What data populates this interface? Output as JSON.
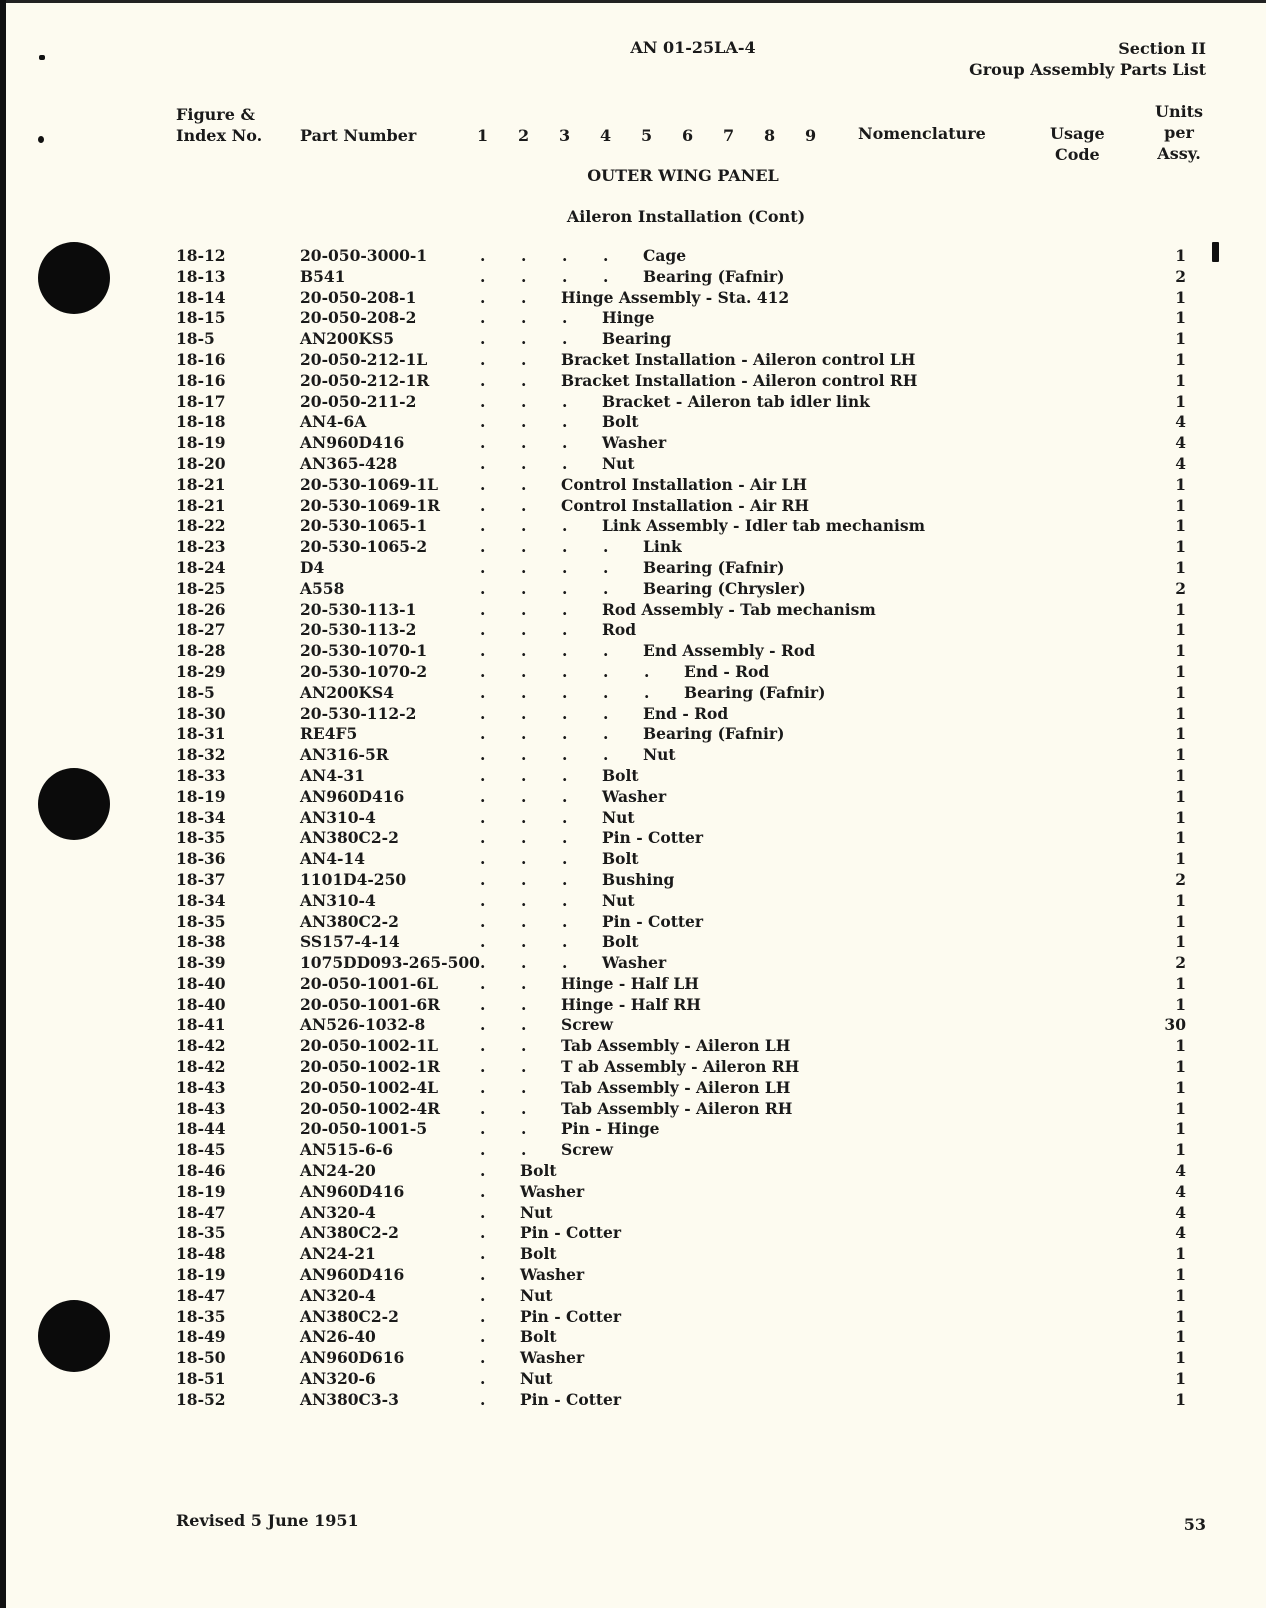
{
  "header": {
    "doc_number": "AN 01-25LA-4",
    "section": "Section II",
    "section_title": "Group Assembly Parts List"
  },
  "columns": {
    "figure_index": [
      "Figure &",
      "Index No."
    ],
    "part_number": "Part Number",
    "indent_levels": [
      "1",
      "2",
      "3",
      "4",
      "5",
      "6",
      "7",
      "8",
      "9"
    ],
    "nomenclature": "Nomenclature",
    "usage_code": [
      "Usage",
      "Code"
    ],
    "units_per_assy": [
      "Units",
      "per",
      "Assy."
    ]
  },
  "group_title": "OUTER WING PANEL",
  "subgroup_title": "Aileron Installation (Cont)",
  "parts": [
    {
      "fig": "18-12",
      "part": "20-050-3000-1",
      "indent": 4,
      "name": "Cage",
      "qty": "1"
    },
    {
      "fig": "18-13",
      "part": "B541",
      "indent": 4,
      "name": "Bearing (Fafnir)",
      "qty": "2"
    },
    {
      "fig": "18-14",
      "part": "20-050-208-1",
      "indent": 2,
      "name": "Hinge Assembly - Sta. 412",
      "qty": "1"
    },
    {
      "fig": "18-15",
      "part": "20-050-208-2",
      "indent": 3,
      "name": "Hinge",
      "qty": "1"
    },
    {
      "fig": "18-5",
      "part": "AN200KS5",
      "indent": 3,
      "name": "Bearing",
      "qty": "1"
    },
    {
      "fig": "18-16",
      "part": "20-050-212-1L",
      "indent": 2,
      "name": "Bracket Installation - Aileron control LH",
      "qty": "1"
    },
    {
      "fig": "18-16",
      "part": "20-050-212-1R",
      "indent": 2,
      "name": "Bracket Installation - Aileron control RH",
      "qty": "1"
    },
    {
      "fig": "18-17",
      "part": "20-050-211-2",
      "indent": 3,
      "name": "Bracket - Aileron tab idler link",
      "qty": "1"
    },
    {
      "fig": "18-18",
      "part": "AN4-6A",
      "indent": 3,
      "name": "Bolt",
      "qty": "4"
    },
    {
      "fig": "18-19",
      "part": "AN960D416",
      "indent": 3,
      "name": "Washer",
      "qty": "4"
    },
    {
      "fig": "18-20",
      "part": "AN365-428",
      "indent": 3,
      "name": "Nut",
      "qty": "4"
    },
    {
      "fig": "18-21",
      "part": "20-530-1069-1L",
      "indent": 2,
      "name": "Control Installation - Air LH",
      "qty": "1"
    },
    {
      "fig": "18-21",
      "part": "20-530-1069-1R",
      "indent": 2,
      "name": "Control Installation - Air RH",
      "qty": "1"
    },
    {
      "fig": "18-22",
      "part": "20-530-1065-1",
      "indent": 3,
      "name": "Link Assembly - Idler tab mechanism",
      "qty": "1"
    },
    {
      "fig": "18-23",
      "part": "20-530-1065-2",
      "indent": 4,
      "name": "Link",
      "qty": "1"
    },
    {
      "fig": "18-24",
      "part": "D4",
      "indent": 4,
      "name": "Bearing (Fafnir)",
      "qty": "1"
    },
    {
      "fig": "18-25",
      "part": "A558",
      "indent": 4,
      "name": "Bearing (Chrysler)",
      "qty": "2"
    },
    {
      "fig": "18-26",
      "part": "20-530-113-1",
      "indent": 3,
      "name": "Rod Assembly - Tab mechanism",
      "qty": "1"
    },
    {
      "fig": "18-27",
      "part": "20-530-113-2",
      "indent": 3,
      "name": "Rod",
      "qty": "1"
    },
    {
      "fig": "18-28",
      "part": "20-530-1070-1",
      "indent": 4,
      "name": "End Assembly - Rod",
      "qty": "1"
    },
    {
      "fig": "18-29",
      "part": "20-530-1070-2",
      "indent": 5,
      "name": "End - Rod",
      "qty": "1"
    },
    {
      "fig": "18-5",
      "part": "AN200KS4",
      "indent": 5,
      "name": "Bearing (Fafnir)",
      "qty": "1"
    },
    {
      "fig": "18-30",
      "part": "20-530-112-2",
      "indent": 4,
      "name": "End - Rod",
      "qty": "1"
    },
    {
      "fig": "18-31",
      "part": "RE4F5",
      "indent": 4,
      "name": "Bearing (Fafnir)",
      "qty": "1"
    },
    {
      "fig": "18-32",
      "part": "AN316-5R",
      "indent": 4,
      "name": "Nut",
      "qty": "1"
    },
    {
      "fig": "18-33",
      "part": "AN4-31",
      "indent": 3,
      "name": "Bolt",
      "qty": "1"
    },
    {
      "fig": "18-19",
      "part": "AN960D416",
      "indent": 3,
      "name": "Washer",
      "qty": "1"
    },
    {
      "fig": "18-34",
      "part": "AN310-4",
      "indent": 3,
      "name": "Nut",
      "qty": "1"
    },
    {
      "fig": "18-35",
      "part": "AN380C2-2",
      "indent": 3,
      "name": "Pin - Cotter",
      "qty": "1"
    },
    {
      "fig": "18-36",
      "part": "AN4-14",
      "indent": 3,
      "name": "Bolt",
      "qty": "1"
    },
    {
      "fig": "18-37",
      "part": "1101D4-250",
      "indent": 3,
      "name": "Bushing",
      "qty": "2"
    },
    {
      "fig": "18-34",
      "part": "AN310-4",
      "indent": 3,
      "name": "Nut",
      "qty": "1"
    },
    {
      "fig": "18-35",
      "part": "AN380C2-2",
      "indent": 3,
      "name": "Pin - Cotter",
      "qty": "1"
    },
    {
      "fig": "18-38",
      "part": "SS157-4-14",
      "indent": 3,
      "name": "Bolt",
      "qty": "1"
    },
    {
      "fig": "18-39",
      "part": "1075DD093-265-500.",
      "indent": 3,
      "name": "Washer",
      "qty": "2",
      "dots_from": 2
    },
    {
      "fig": "18-40",
      "part": "20-050-1001-6L",
      "indent": 2,
      "name": "Hinge - Half LH",
      "qty": "1"
    },
    {
      "fig": "18-40",
      "part": "20-050-1001-6R",
      "indent": 2,
      "name": "Hinge - Half RH",
      "qty": "1"
    },
    {
      "fig": "18-41",
      "part": "AN526-1032-8",
      "indent": 2,
      "name": "Screw",
      "qty": "30"
    },
    {
      "fig": "18-42",
      "part": "20-050-1002-1L",
      "indent": 2,
      "name": "Tab Assembly - Aileron LH",
      "qty": "1"
    },
    {
      "fig": "18-42",
      "part": "20-050-1002-1R",
      "indent": 2,
      "name": "T ab Assembly - Aileron RH",
      "qty": "1"
    },
    {
      "fig": "18-43",
      "part": "20-050-1002-4L",
      "indent": 2,
      "name": "Tab Assembly - Aileron LH",
      "qty": "1"
    },
    {
      "fig": "18-43",
      "part": "20-050-1002-4R",
      "indent": 2,
      "name": "Tab Assembly - Aileron RH",
      "qty": "1"
    },
    {
      "fig": "18-44",
      "part": "20-050-1001-5",
      "indent": 2,
      "name": "Pin - Hinge",
      "qty": "1"
    },
    {
      "fig": "18-45",
      "part": "AN515-6-6",
      "indent": 2,
      "name": "Screw",
      "qty": "1"
    },
    {
      "fig": "18-46",
      "part": "AN24-20",
      "indent": 1,
      "name": "Bolt",
      "qty": "4"
    },
    {
      "fig": "18-19",
      "part": "AN960D416",
      "indent": 1,
      "name": "Washer",
      "qty": "4"
    },
    {
      "fig": "18-47",
      "part": "AN320-4",
      "indent": 1,
      "name": "Nut",
      "qty": "4"
    },
    {
      "fig": "18-35",
      "part": "AN380C2-2",
      "indent": 1,
      "name": "Pin - Cotter",
      "qty": "4"
    },
    {
      "fig": "18-48",
      "part": "AN24-21",
      "indent": 1,
      "name": "Bolt",
      "qty": "1"
    },
    {
      "fig": "18-19",
      "part": "AN960D416",
      "indent": 1,
      "name": "Washer",
      "qty": "1"
    },
    {
      "fig": "18-47",
      "part": "AN320-4",
      "indent": 1,
      "name": "Nut",
      "qty": "1"
    },
    {
      "fig": "18-35",
      "part": "AN380C2-2",
      "indent": 1,
      "name": "Pin - Cotter",
      "qty": "1"
    },
    {
      "fig": "18-49",
      "part": "AN26-40",
      "indent": 1,
      "name": "Bolt",
      "qty": "1"
    },
    {
      "fig": "18-50",
      "part": "AN960D616",
      "indent": 1,
      "name": "Washer",
      "qty": "1"
    },
    {
      "fig": "18-51",
      "part": "AN320-6",
      "indent": 1,
      "name": "Nut",
      "qty": "1"
    },
    {
      "fig": "18-52",
      "part": "AN380C3-3",
      "indent": 1,
      "name": "Pin - Cotter",
      "qty": "1"
    }
  ],
  "footer": {
    "revision": "Revised 5 June 1951",
    "page_number": "53"
  }
}
